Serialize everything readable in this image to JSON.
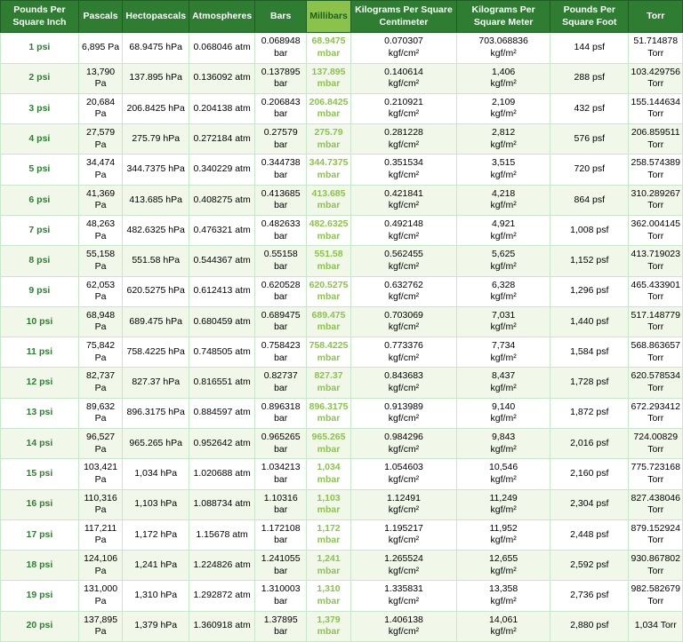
{
  "headers": [
    {
      "label": "Pounds Per Square Inch",
      "highlight": false
    },
    {
      "label": "Pascals",
      "highlight": false
    },
    {
      "label": "Hectopascals",
      "highlight": false
    },
    {
      "label": "Atmospheres",
      "highlight": false
    },
    {
      "label": "Bars",
      "highlight": false
    },
    {
      "label": "Millibars",
      "highlight": true
    },
    {
      "label": "Kilograms Per Square Centimeter",
      "highlight": false
    },
    {
      "label": "Kilograms Per Square Meter",
      "highlight": false
    },
    {
      "label": "Pounds Per Square Foot",
      "highlight": false
    },
    {
      "label": "Torr",
      "highlight": false
    }
  ],
  "rows": [
    [
      "1 psi",
      "6,895 Pa",
      "68.9475 hPa",
      "0.068046 atm",
      "0.068948 bar",
      "68.9475\nmbar",
      "0.070307\nkgf/cm²",
      "703.068836\nkgf/m²",
      "144 psf",
      "51.714878\nTorr"
    ],
    [
      "2 psi",
      "13,790 Pa",
      "137.895 hPa",
      "0.136092 atm",
      "0.137895 bar",
      "137.895\nmbar",
      "0.140614\nkgf/cm²",
      "1,406\nkgf/m²",
      "288 psf",
      "103.429756\nTorr"
    ],
    [
      "3 psi",
      "20,684 Pa",
      "206.8425 hPa",
      "0.204138 atm",
      "0.206843 bar",
      "206.8425\nmbar",
      "0.210921\nkgf/cm²",
      "2,109\nkgf/m²",
      "432 psf",
      "155.144634\nTorr"
    ],
    [
      "4 psi",
      "27,579 Pa",
      "275.79 hPa",
      "0.272184 atm",
      "0.27579 bar",
      "275.79\nmbar",
      "0.281228\nkgf/cm²",
      "2,812\nkgf/m²",
      "576 psf",
      "206.859511\nTorr"
    ],
    [
      "5 psi",
      "34,474 Pa",
      "344.7375 hPa",
      "0.340229 atm",
      "0.344738 bar",
      "344.7375\nmbar",
      "0.351534\nkgf/cm²",
      "3,515\nkgf/m²",
      "720 psf",
      "258.574389\nTorr"
    ],
    [
      "6 psi",
      "41,369 Pa",
      "413.685 hPa",
      "0.408275 atm",
      "0.413685 bar",
      "413.685\nmbar",
      "0.421841\nkgf/cm²",
      "4,218\nkgf/m²",
      "864 psf",
      "310.289267\nTorr"
    ],
    [
      "7 psi",
      "48,263 Pa",
      "482.6325 hPa",
      "0.476321 atm",
      "0.482633 bar",
      "482.6325\nmbar",
      "0.492148\nkgf/cm²",
      "4,921\nkgf/m²",
      "1,008 psf",
      "362.004145\nTorr"
    ],
    [
      "8 psi",
      "55,158 Pa",
      "551.58 hPa",
      "0.544367 atm",
      "0.55158 bar",
      "551.58\nmbar",
      "0.562455\nkgf/cm²",
      "5,625\nkgf/m²",
      "1,152 psf",
      "413.719023\nTorr"
    ],
    [
      "9 psi",
      "62,053 Pa",
      "620.5275 hPa",
      "0.612413 atm",
      "0.620528 bar",
      "620.5275\nmbar",
      "0.632762\nkgf/cm²",
      "6,328\nkgf/m²",
      "1,296 psf",
      "465.433901\nTorr"
    ],
    [
      "10 psi",
      "68,948 Pa",
      "689.475 hPa",
      "0.680459 atm",
      "0.689475 bar",
      "689.475\nmbar",
      "0.703069\nkgf/cm²",
      "7,031\nkgf/m²",
      "1,440 psf",
      "517.148779\nTorr"
    ],
    [
      "11 psi",
      "75,842 Pa",
      "758.4225 hPa",
      "0.748505 atm",
      "0.758423 bar",
      "758.4225\nmbar",
      "0.773376\nkgf/cm²",
      "7,734\nkgf/m²",
      "1,584 psf",
      "568.863657\nTorr"
    ],
    [
      "12 psi",
      "82,737 Pa",
      "827.37 hPa",
      "0.816551 atm",
      "0.82737 bar",
      "827.37\nmbar",
      "0.843683\nkgf/cm²",
      "8,437\nkgf/m²",
      "1,728 psf",
      "620.578534\nTorr"
    ],
    [
      "13 psi",
      "89,632 Pa",
      "896.3175 hPa",
      "0.884597 atm",
      "0.896318 bar",
      "896.3175\nmbar",
      "0.913989\nkgf/cm²",
      "9,140\nkgf/m²",
      "1,872 psf",
      "672.293412\nTorr"
    ],
    [
      "14 psi",
      "96,527 Pa",
      "965.265 hPa",
      "0.952642 atm",
      "0.965265 bar",
      "965.265\nmbar",
      "0.984296\nkgf/cm²",
      "9,843\nkgf/m²",
      "2,016 psf",
      "724.00829\nTorr"
    ],
    [
      "15 psi",
      "103,421\nPa",
      "1,034 hPa",
      "1.020688 atm",
      "1.034213 bar",
      "1,034\nmbar",
      "1.054603\nkgf/cm²",
      "10,546\nkgf/m²",
      "2,160 psf",
      "775.723168\nTorr"
    ],
    [
      "16 psi",
      "110,316\nPa",
      "1,103 hPa",
      "1.088734 atm",
      "1.10316 bar",
      "1,103\nmbar",
      "1.12491\nkgf/cm²",
      "11,249\nkgf/m²",
      "2,304 psf",
      "827.438046\nTorr"
    ],
    [
      "17 psi",
      "117,211\nPa",
      "1,172 hPa",
      "1.15678 atm",
      "1.172108 bar",
      "1,172\nmbar",
      "1.195217\nkgf/cm²",
      "11,952\nkgf/m²",
      "2,448 psf",
      "879.152924\nTorr"
    ],
    [
      "18 psi",
      "124,106\nPa",
      "1,241 hPa",
      "1.224826 atm",
      "1.241055 bar",
      "1,241\nmbar",
      "1.265524\nkgf/cm²",
      "12,655\nkgf/m²",
      "2,592 psf",
      "930.867802\nTorr"
    ],
    [
      "19 psi",
      "131,000\nPa",
      "1,310 hPa",
      "1.292872 atm",
      "1.310003 bar",
      "1,310\nmbar",
      "1.335831\nkgf/cm²",
      "13,358\nkgf/m²",
      "2,736 psf",
      "982.582679\nTorr"
    ],
    [
      "20 psi",
      "137,895\nPa",
      "1,379 hPa",
      "1.360918 atm",
      "1.37895 bar",
      "1,379\nmbar",
      "1.406138\nkgf/cm²",
      "14,061\nkgf/m²",
      "2,880 psf",
      "1,034 Torr"
    ]
  ]
}
